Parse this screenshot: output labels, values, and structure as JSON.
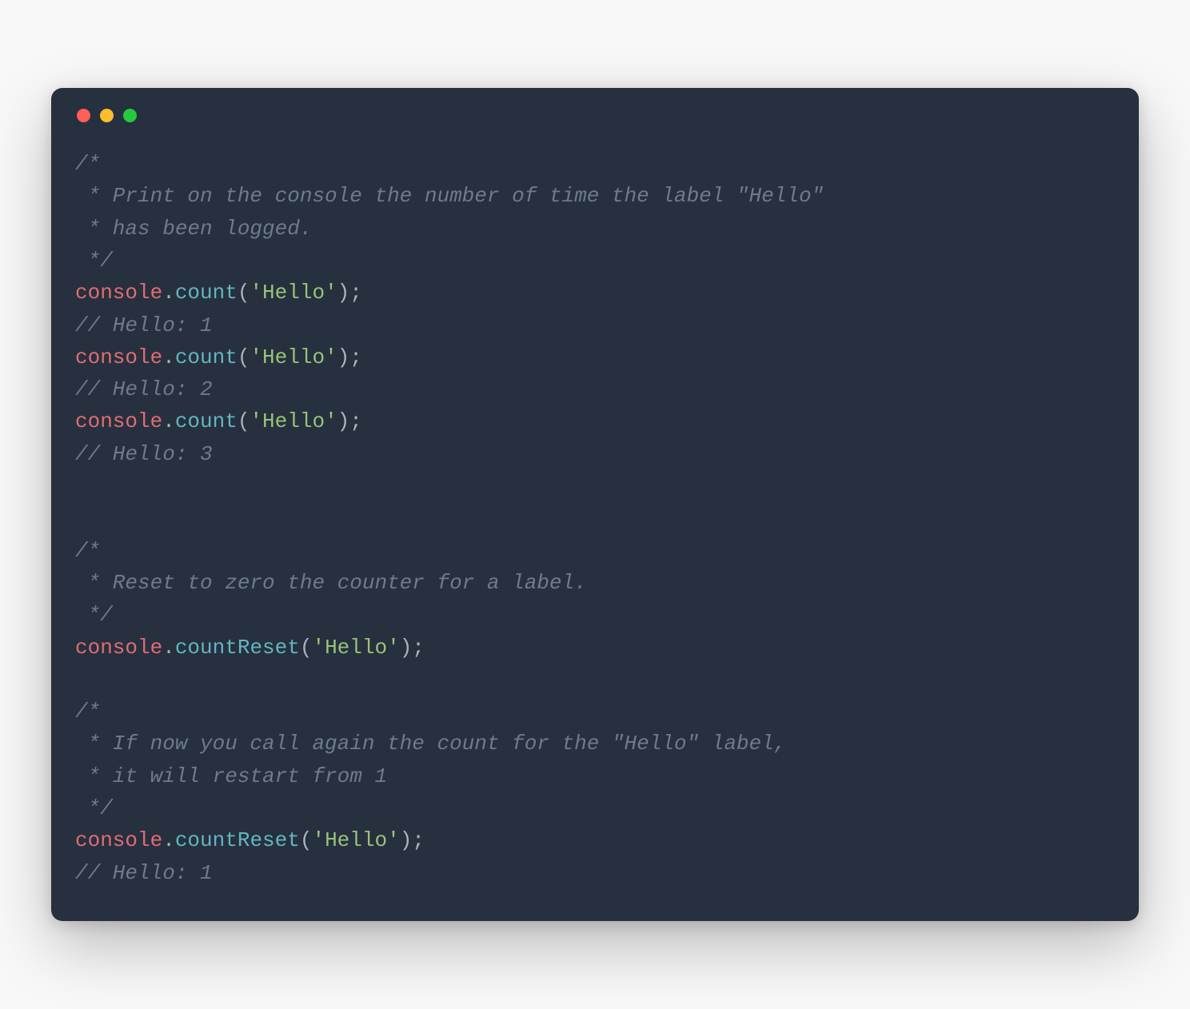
{
  "colors": {
    "window_bg": "#27303e",
    "page_bg": "#f8f8f8",
    "comment": "#6f7a8a",
    "object": "#e06c75",
    "method": "#61b6c2",
    "string": "#98c379",
    "punct": "#abb2bf",
    "traffic_red": "#ff5f56",
    "traffic_yellow": "#ffbd2e",
    "traffic_green": "#27c93f"
  },
  "code": {
    "lines": [
      {
        "type": "comment",
        "text": "/*"
      },
      {
        "type": "comment",
        "text": " * Print on the console the number of time the label \"Hello\""
      },
      {
        "type": "comment",
        "text": " * has been logged."
      },
      {
        "type": "comment",
        "text": " */"
      },
      {
        "type": "call",
        "object": "console",
        "method": "count",
        "arg": "'Hello'"
      },
      {
        "type": "comment",
        "text": "// Hello: 1"
      },
      {
        "type": "call",
        "object": "console",
        "method": "count",
        "arg": "'Hello'"
      },
      {
        "type": "comment",
        "text": "// Hello: 2"
      },
      {
        "type": "call",
        "object": "console",
        "method": "count",
        "arg": "'Hello'"
      },
      {
        "type": "comment",
        "text": "// Hello: 3"
      },
      {
        "type": "blank"
      },
      {
        "type": "blank"
      },
      {
        "type": "comment",
        "text": "/*"
      },
      {
        "type": "comment",
        "text": " * Reset to zero the counter for a label."
      },
      {
        "type": "comment",
        "text": " */"
      },
      {
        "type": "call",
        "object": "console",
        "method": "countReset",
        "arg": "'Hello'"
      },
      {
        "type": "blank"
      },
      {
        "type": "comment",
        "text": "/*"
      },
      {
        "type": "comment",
        "text": " * If now you call again the count for the \"Hello\" label,"
      },
      {
        "type": "comment",
        "text": " * it will restart from 1"
      },
      {
        "type": "comment",
        "text": " */"
      },
      {
        "type": "call",
        "object": "console",
        "method": "countReset",
        "arg": "'Hello'"
      },
      {
        "type": "comment",
        "text": "// Hello: 1"
      }
    ]
  }
}
